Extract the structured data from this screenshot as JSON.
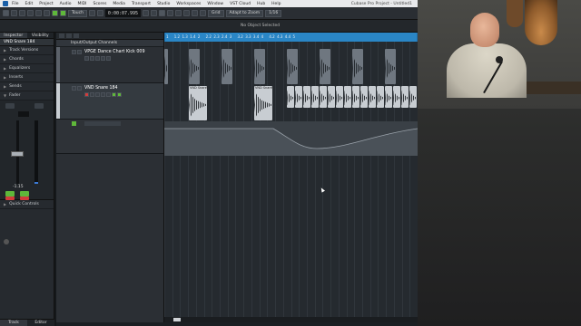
{
  "menubar": {
    "items": [
      "File",
      "Edit",
      "Project",
      "Audio",
      "MIDI",
      "Scores",
      "Media",
      "Transport",
      "Studio",
      "Workspaces",
      "Window",
      "VST Cloud",
      "Hub",
      "Help"
    ],
    "window_title": "Cubase Pro Project - Untitled1"
  },
  "toolbar": {
    "mode": "Touch",
    "timecode": "0:00:07.995",
    "snap_type": "Grid",
    "quantize_mode": "Adapt to Zoom",
    "quantize_value": "1/16"
  },
  "status": {
    "no_object": "No Object Selected"
  },
  "inspector": {
    "tabs": [
      "Inspector",
      "Visibility"
    ],
    "track_name": "VND Snare 184",
    "sections": [
      "Track Versions",
      "Chords",
      "Equalizers",
      "Inserts",
      "Sends",
      "Fader"
    ],
    "volume_value": "-1.15",
    "quick_controls": "Quick Controls",
    "meter_level": 0.03,
    "bottom_tabs": [
      "Track",
      "Editor"
    ]
  },
  "tracklist": {
    "folder": "Input/Output Channels",
    "tracks": [
      {
        "name": "VPGE Dance Chart Kick 009"
      },
      {
        "name": "VND Snare 184"
      }
    ]
  },
  "ruler": {
    "bars": [
      "1",
      "1.2",
      "1.3",
      "1.4",
      "2",
      "2.2",
      "2.3",
      "2.4",
      "3",
      "3.2",
      "3.3",
      "3.4",
      "4",
      "4.2",
      "4.3",
      "4.4",
      "5"
    ]
  },
  "events": {
    "snare_label": "VND Snare"
  },
  "colors": {
    "accent_blue": "#1f6ea8",
    "mute_red": "#d23c3c",
    "active_green": "#5fb83a"
  }
}
